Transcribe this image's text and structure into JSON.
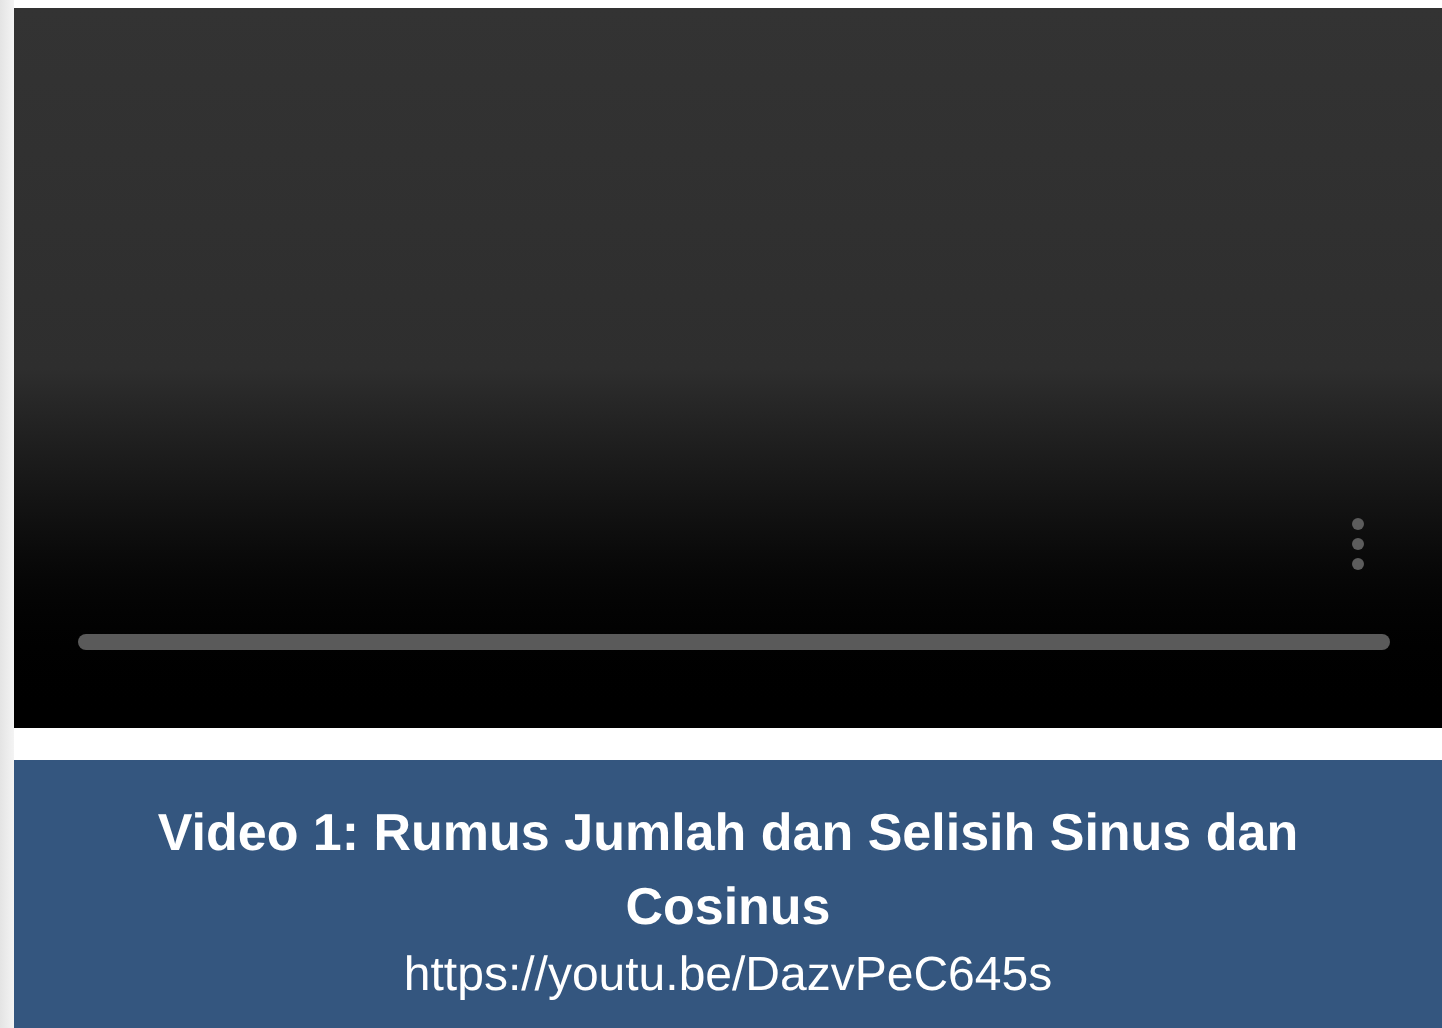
{
  "video": {
    "kind": "video_player"
  },
  "caption": {
    "title": "Video 1: Rumus Jumlah dan Selisih Sinus dan Cosinus",
    "link": "https://youtu.be/DazvPeC645s"
  }
}
